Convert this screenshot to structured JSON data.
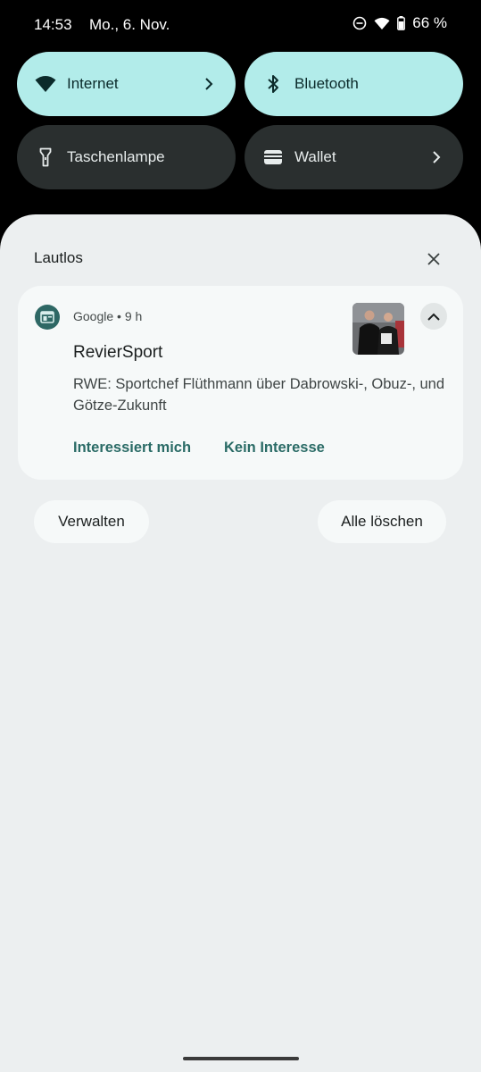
{
  "status_bar": {
    "time": "14:53",
    "date": "Mo., 6. Nov.",
    "battery": "66 %",
    "icons": [
      "dnd-icon",
      "wifi-icon",
      "battery-icon"
    ]
  },
  "quick_tiles": [
    {
      "label": "Internet",
      "icon": "wifi-icon",
      "state": "on",
      "chevron": true
    },
    {
      "label": "Bluetooth",
      "icon": "bluetooth-icon",
      "state": "on",
      "chevron": false
    },
    {
      "label": "Taschenlampe",
      "icon": "flashlight-icon",
      "state": "off",
      "chevron": false
    },
    {
      "label": "Wallet",
      "icon": "wallet-icon",
      "state": "off",
      "chevron": true
    }
  ],
  "shade": {
    "section_title": "Lautlos",
    "notification": {
      "app": "Google",
      "time": "9 h",
      "title": "RevierSport",
      "body": "RWE: Sportchef Flüthmann über Dabrowski-, Obuz-, und Götze-Zukunft",
      "actions": [
        "Interessiert mich",
        "Kein Interesse"
      ]
    },
    "buttons": {
      "manage": "Verwalten",
      "clear_all": "Alle löschen"
    }
  },
  "colors": {
    "tile_on": "#b2ecea",
    "tile_off": "#2a2f2f",
    "accent": "#2a6b66",
    "shade_bg": "#eceff0"
  }
}
